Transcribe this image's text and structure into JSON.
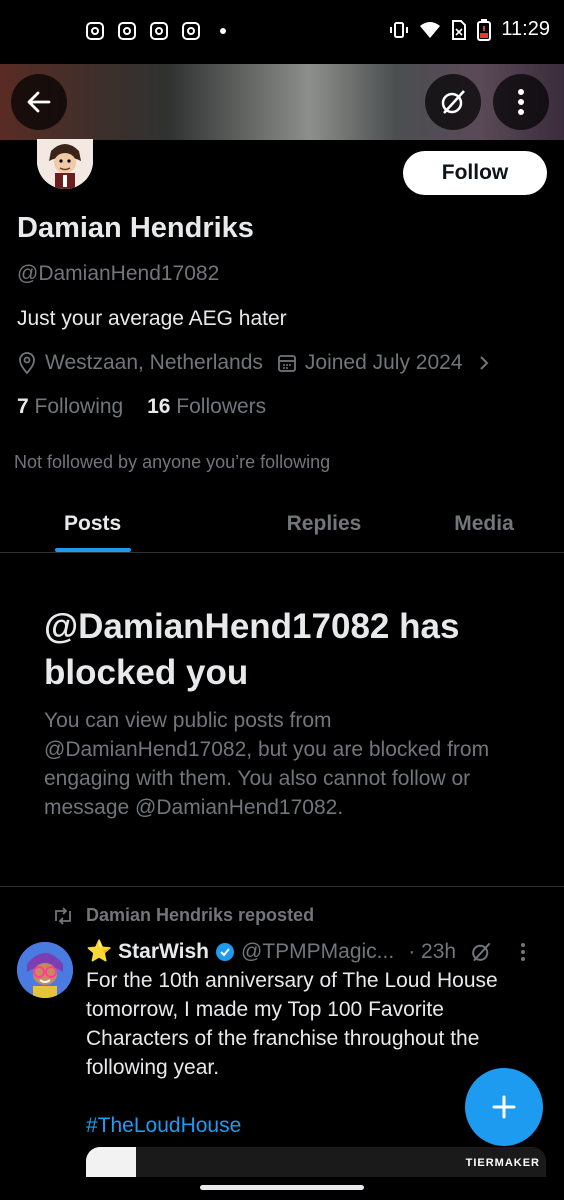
{
  "status_bar": {
    "time": "11:29",
    "icons": [
      "instagram-icon",
      "instagram-icon",
      "instagram-icon",
      "instagram-icon",
      "notification-dot",
      "vibrate-icon",
      "wifi-icon",
      "sim-icon",
      "battery-icon"
    ]
  },
  "header": {
    "back_icon": "arrow-left-icon",
    "grok_icon": "grok-icon",
    "more_icon": "more-vertical-icon"
  },
  "profile": {
    "follow_label": "Follow",
    "name": "Damian Hendriks",
    "handle": "@DamianHend17082",
    "bio": "Just your average AEG hater",
    "location": "Westzaan, Netherlands",
    "joined": "Joined July 2024",
    "following_count": "7",
    "following_label": "Following",
    "followers_count": "16",
    "followers_label": "Followers",
    "not_followed": "Not followed by anyone you’re following"
  },
  "tabs": [
    {
      "label": "Posts",
      "active": true
    },
    {
      "label": "Replies",
      "active": false
    },
    {
      "label": "Media",
      "active": false
    }
  ],
  "blocked": {
    "title": "@DamianHend17082 has blocked you",
    "description": "You can view public posts from @DamianHend17082, but you are blocked from engaging with them. You also cannot follow or message @DamianHend17082."
  },
  "tweet": {
    "repost_label": "Damian Hendriks reposted",
    "author_emoji": "⭐",
    "author_name": "StarWish",
    "author_handle": "@TPMPMagic...",
    "time": "· 23h",
    "text": "For the 10th anniversary of The Loud House tomorrow, I made my Top 100 Favorite Characters of the franchise throughout the following year.",
    "hashtag": "#TheLoudHouse",
    "card_brand": "TIERMAKER"
  },
  "fab_icon": "plus-icon",
  "colors": {
    "background": "#000000",
    "text": "#e7e9ea",
    "muted": "#71767b",
    "accent": "#1d9bf0",
    "divider": "#2f3336"
  }
}
